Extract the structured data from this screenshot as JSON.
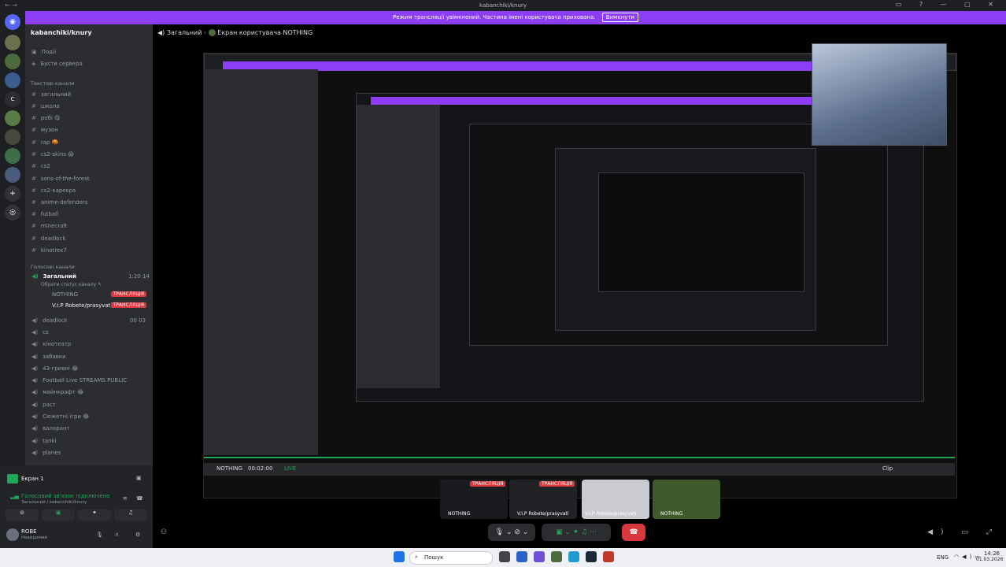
{
  "window": {
    "title": "kabanchiki/knury",
    "nav": "← →",
    "controls": "▭ ? — ▢ ✕"
  },
  "banner": {
    "text": "Режим трансляції увімкнений. Частина імені користувача прихована.",
    "button": "Вимкнути"
  },
  "server": {
    "name": "kabanchiki/knury"
  },
  "top_links": [
    "Події",
    "Бусти сервера"
  ],
  "text_category": "Текстові канали",
  "text_channels": [
    "загальний",
    "школа",
    "робі 😋",
    "музон",
    "rap 🤬",
    "cs2-skins 😱",
    "cs2",
    "sons-of-the-forest",
    "cs2-кареєра",
    "anime-defenders",
    "futball",
    "minecraft",
    "deadlock",
    "kinotrex7"
  ],
  "voice_category": "Голосові канали",
  "voice_active": {
    "name": "Загальний",
    "sub": "Обрати статус каналу ✎",
    "time": "1:20:14"
  },
  "voice_users": [
    {
      "name": "NOTHING",
      "badge": "ТРАНСЛЯЦІЯ"
    },
    {
      "name": "V.I.P Robete/prasyvati",
      "badge": "ТРАНСЛЯЦІЯ"
    }
  ],
  "voice_channels": [
    {
      "name": "deadlock",
      "extra": "00  03"
    },
    {
      "name": "cs",
      "extra": ""
    },
    {
      "name": "кінотеатр",
      "extra": ""
    },
    {
      "name": "забавки",
      "extra": ""
    },
    {
      "name": "43-гривні 😂",
      "extra": ""
    },
    {
      "name": "Football Live STREAMS PUBLIC",
      "extra": ""
    },
    {
      "name": "майнкрафт 😂",
      "extra": ""
    },
    {
      "name": "раст",
      "extra": ""
    },
    {
      "name": "Сюжетні ігри 😂",
      "extra": ""
    },
    {
      "name": "валорант",
      "extra": ""
    },
    {
      "name": "tanki",
      "extra": ""
    },
    {
      "name": "planes",
      "extra": ""
    }
  ],
  "screen_panel": {
    "title": "Екран 1"
  },
  "voice_status": {
    "title": "Голосовий зв'язок підключено",
    "sub": "Загальний / kabanchiki/knury"
  },
  "user": {
    "name": "ROBE",
    "status": "Невидимий"
  },
  "breadcrumb": {
    "channel": "Загальний",
    "screen": "Екран користувача NOTHING"
  },
  "stream_bar": {
    "user": "NOTHING",
    "time": "00:02:00",
    "live": "LIVE",
    "clip": "Clip"
  },
  "tiles": [
    {
      "name": "NOTHING",
      "badge": "ТРАНСЛЯЦІЯ"
    },
    {
      "name": "V.I.P Robete/prasyvati",
      "badge": "ТРАНСЛЯЦІЯ"
    },
    {
      "name": "V.I.P Robete/prasyvati",
      "badge": ""
    },
    {
      "name": "NOTHING",
      "badge": ""
    }
  ],
  "taskbar": {
    "search": "Пошук",
    "lang": "ENG",
    "time": "14:26",
    "date": "01.03.2026"
  },
  "colors": {
    "accent": "#8c3ef5",
    "live": "#da373c",
    "online": "#23a55a"
  }
}
